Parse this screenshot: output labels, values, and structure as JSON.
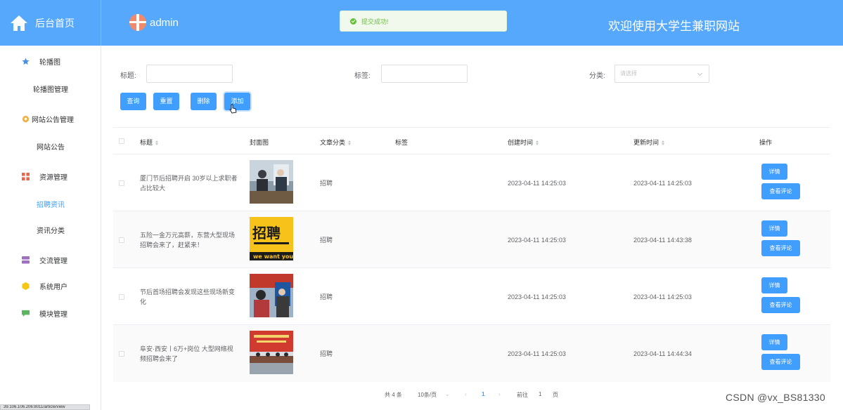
{
  "header": {
    "home_label": "后台首页",
    "user_name": "admin",
    "toast_text": "提交成功!",
    "welcome_text": "欢迎使用大学生兼职网站",
    "brand_color": "#55a8fb"
  },
  "sidebar": {
    "items": [
      {
        "label": "轮播图",
        "icon": "star-icon"
      },
      {
        "label": "轮播图管理",
        "sub": true
      },
      {
        "label": "网站公告管理",
        "icon": "gear-icon"
      },
      {
        "label": "网站公告",
        "sub": true
      },
      {
        "label": "资源管理",
        "icon": "grid-icon"
      },
      {
        "label": "招聘资讯",
        "sub": true,
        "active": true
      },
      {
        "label": "资讯分类",
        "sub": true
      },
      {
        "label": "交流管理",
        "icon": "database-icon"
      },
      {
        "label": "系统用户",
        "icon": "cube-icon"
      },
      {
        "label": "模块管理",
        "icon": "chat-icon"
      }
    ]
  },
  "statusbar": "39.106.106.206:8011/article/view",
  "filters": {
    "title_label": "标题:",
    "tag_label": "标签:",
    "category_label": "分类:",
    "category_placeholder": "请选择"
  },
  "actions": {
    "query": "查询",
    "reset": "重置",
    "delete": "删除",
    "add": "添加"
  },
  "table": {
    "headers": {
      "title": "标题",
      "cover": "封面图",
      "category": "文章分类",
      "tag": "标签",
      "created": "创建时间",
      "updated": "更新时间",
      "ops": "操作"
    },
    "rows": [
      {
        "title": "厦门节后招聘开启 30岁以上求职者占比较大",
        "category": "招聘",
        "tag": "",
        "created": "2023-04-11 14:25:03",
        "updated": "2023-04-11 14:25:03"
      },
      {
        "title": "五险一金万元高薪，东营大型现场招聘会来了，赶紧来！",
        "category": "招聘",
        "tag": "",
        "created": "2023-04-11 14:25:03",
        "updated": "2023-04-11 14:43:38"
      },
      {
        "title": "节后首场招聘会发现这些现场新变化",
        "category": "招聘",
        "tag": "",
        "created": "2023-04-11 14:25:03",
        "updated": "2023-04-11 14:25:03"
      },
      {
        "title": "阜安·西安丨6万+岗位 大型网络视频招聘会来了",
        "category": "招聘",
        "tag": "",
        "created": "2023-04-11 14:25:03",
        "updated": "2023-04-11 14:44:34"
      }
    ],
    "detail_label": "详情",
    "comments_label": "查看评论",
    "poster_text_top": "招聘",
    "poster_text_bottom": "we want you"
  },
  "pagination": {
    "total": "共 4 条",
    "page_size": "10条/页",
    "current_page": "1",
    "goto_label": "前往",
    "goto_value": "1",
    "page_suffix": "页"
  },
  "watermark": "CSDN @vx_BS81330"
}
